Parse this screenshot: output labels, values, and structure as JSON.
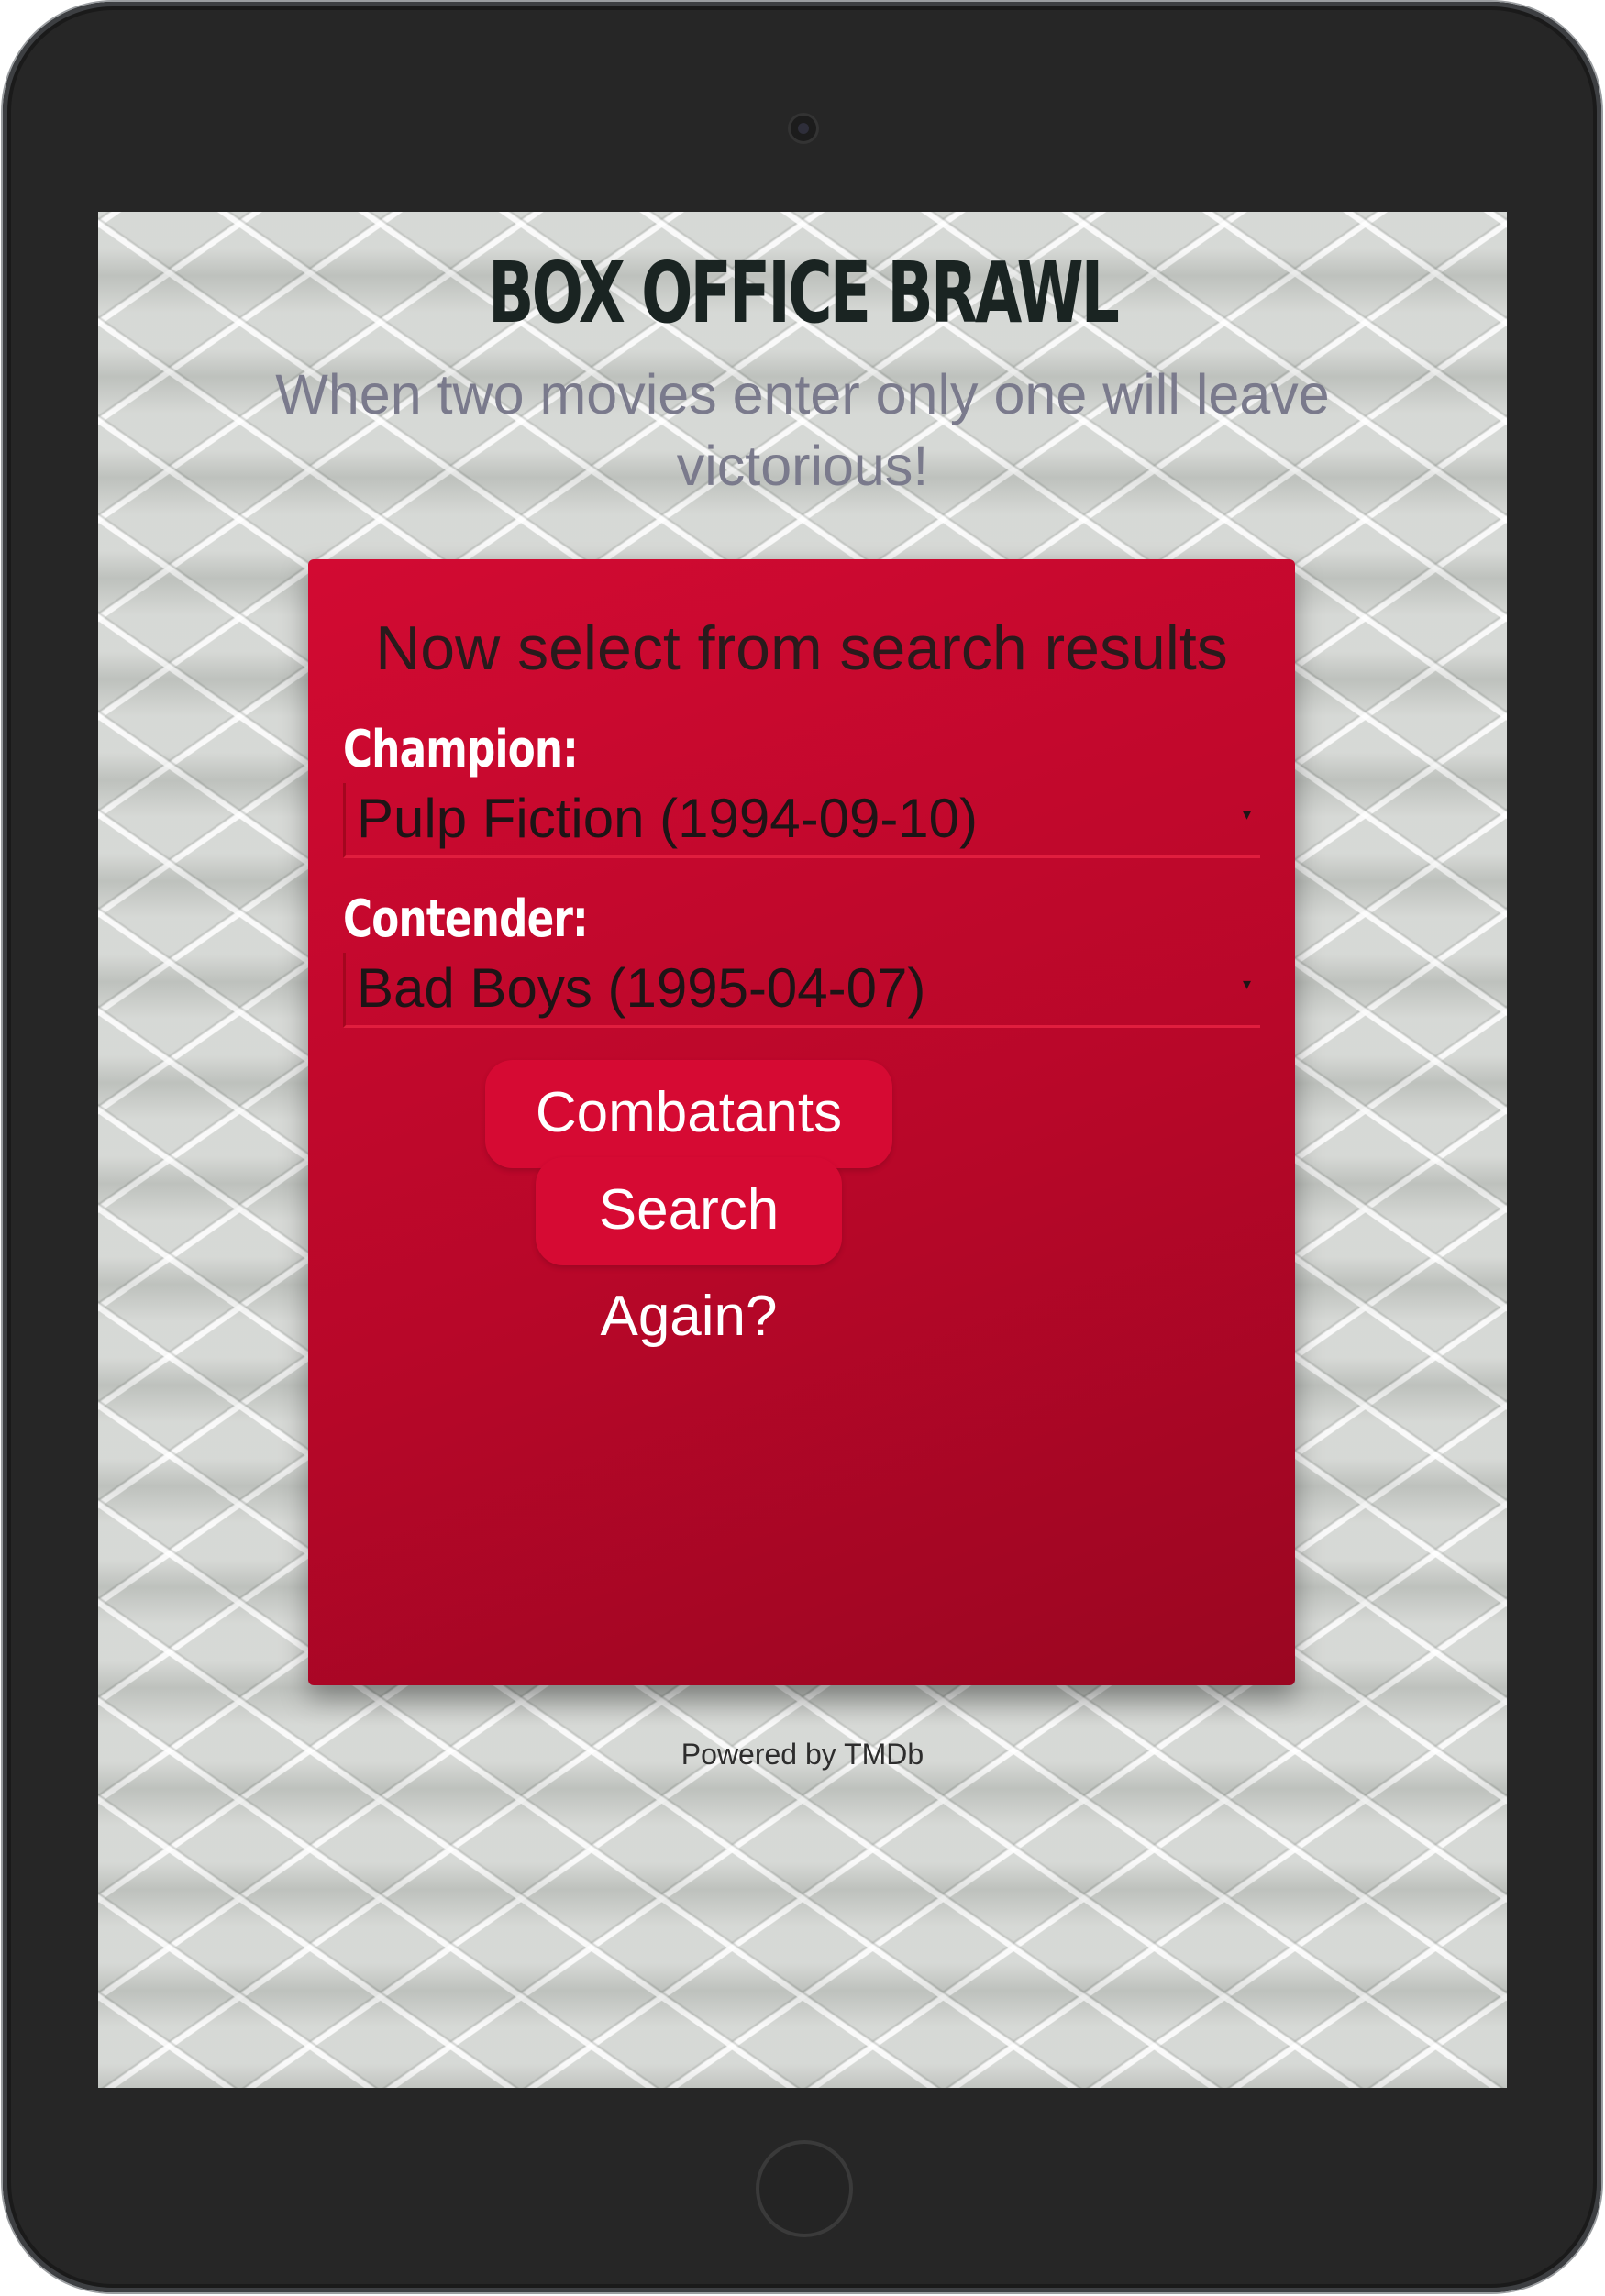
{
  "app": {
    "title": "BOX OFFICE BRAWL",
    "tagline": "When two movies enter only one will leave victorious!"
  },
  "card": {
    "title": "Now select from search results",
    "champion": {
      "label": "Champion:",
      "selected": "Pulp Fiction (1994-09-10)"
    },
    "contender": {
      "label": "Contender:",
      "selected": "Bad Boys (1995-04-07)"
    },
    "ready_button": "Combatants Ready!",
    "search_again_button": "Search Again?"
  },
  "footer": {
    "text": "Powered by TMDb"
  },
  "icons": {
    "dropdown": "▾"
  },
  "colors": {
    "card_red": "#c8082d",
    "button_red": "#d60a33",
    "title_dark": "#1a2422",
    "tagline_gray": "#7a7a8c"
  }
}
